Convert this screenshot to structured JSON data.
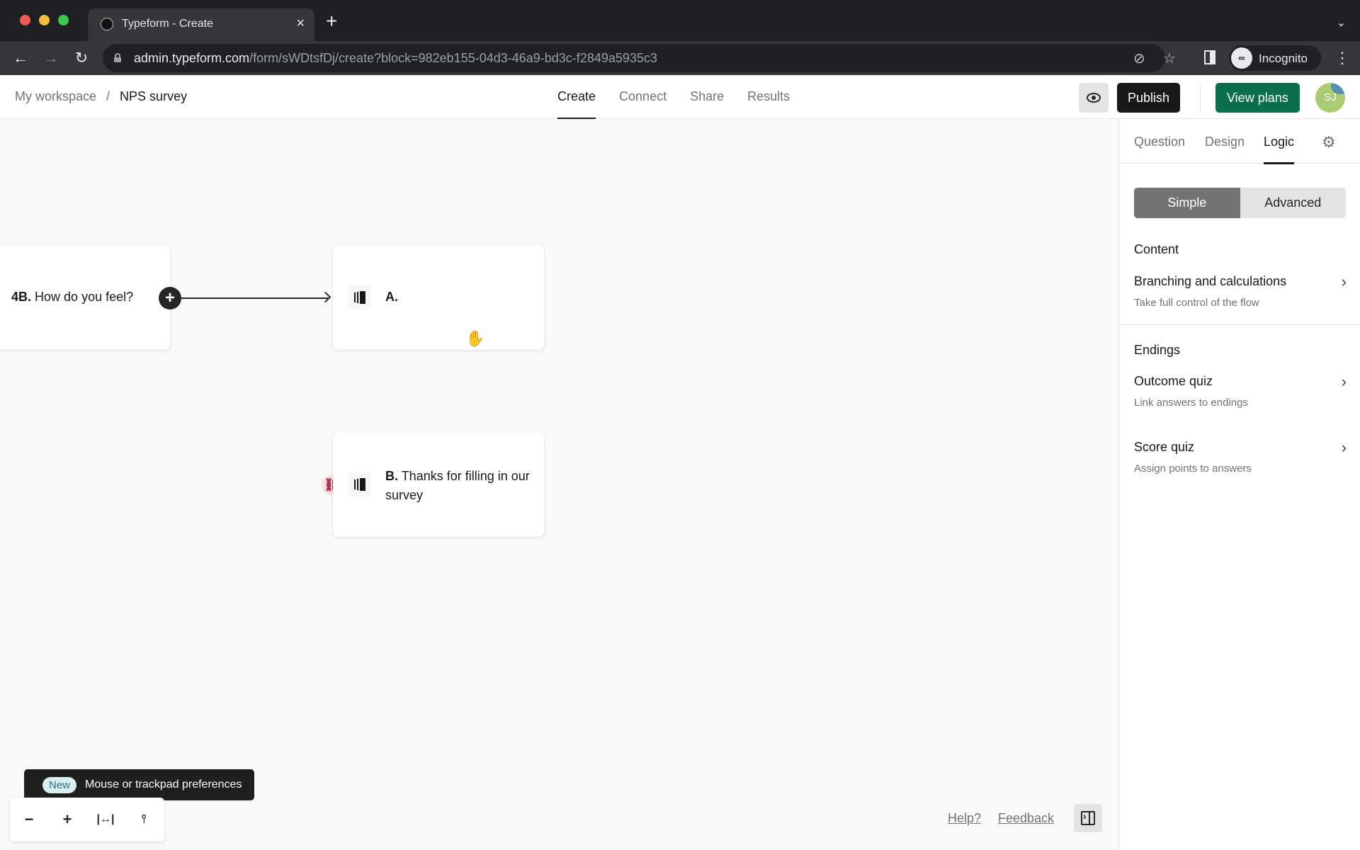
{
  "browser": {
    "tab_title": "Typeform - Create",
    "tab_close": "×",
    "new_tab": "+",
    "tabs_dropdown": "⌄",
    "url_host": "admin.typeform.com",
    "url_path": "/form/sWDtsfDj/create?block=982eb155-04d3-46a9-bd3c-f2849a5935c3",
    "profile_label": "Incognito",
    "nav": {
      "back": "←",
      "forward": "→",
      "reload": "↻"
    },
    "icons": {
      "eye_off": "⊘",
      "star": "☆",
      "kebab": "⋮",
      "incognito": "∞"
    }
  },
  "header": {
    "breadcrumb": {
      "workspace": "My workspace",
      "separator": "/",
      "form": "NPS survey"
    },
    "tabs": [
      {
        "label": "Create",
        "active": true
      },
      {
        "label": "Connect",
        "active": false
      },
      {
        "label": "Share",
        "active": false
      },
      {
        "label": "Results",
        "active": false
      }
    ],
    "publish_label": "Publish",
    "view_plans_label": "View plans",
    "avatar_initials": "SJ",
    "colors": {
      "publish": "#191919",
      "view_plans": "#0b6e4f"
    }
  },
  "canvas": {
    "nodes": [
      {
        "id": "4B",
        "number": "4B.",
        "text": "How do you feel?"
      },
      {
        "id": "A",
        "number": "A.",
        "text": ""
      },
      {
        "id": "B",
        "number": "B.",
        "text": "Thanks for filling in our survey"
      }
    ],
    "add_connector": "+",
    "broken_link_icon": "⛓",
    "cursor": "✋",
    "zoom_controls": {
      "zoom_out": "−",
      "zoom_in": "+",
      "fit": "|↔|",
      "preferences": "⫯"
    },
    "tooltip": {
      "badge": "New",
      "text": "Mouse or trackpad preferences"
    },
    "help_label": "Help?",
    "feedback_label": "Feedback"
  },
  "panel": {
    "tabs": [
      {
        "label": "Question",
        "active": false
      },
      {
        "label": "Design",
        "active": false
      },
      {
        "label": "Logic",
        "active": true
      }
    ],
    "gear": "⚙",
    "mode": {
      "simple": "Simple",
      "advanced": "Advanced",
      "selected": "Simple"
    },
    "sections": {
      "content": "Content",
      "endings": "Endings"
    },
    "items": [
      {
        "title": "Branching and calculations",
        "desc": "Take full control of the flow"
      },
      {
        "title": "Outcome quiz",
        "desc": "Link answers to endings"
      },
      {
        "title": "Score quiz",
        "desc": "Assign points to answers"
      }
    ],
    "chevron": "›"
  }
}
